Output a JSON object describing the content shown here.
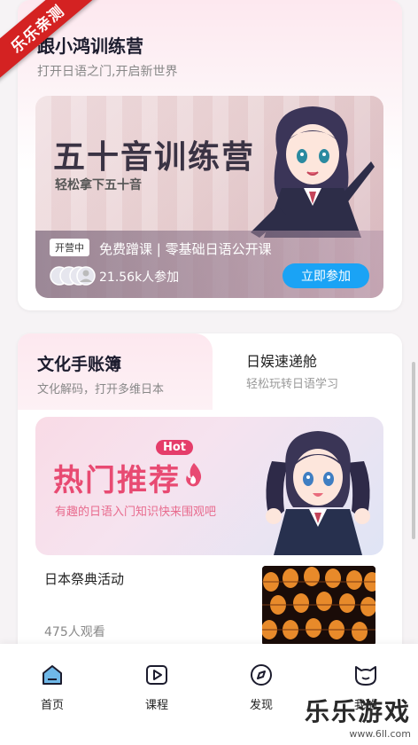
{
  "watermark": {
    "ribbon": "乐乐亲测",
    "site_name": "乐乐游戏",
    "site_url": "www.6ll.com"
  },
  "card1": {
    "title": "跟小鸿训练营",
    "subtitle": "打开日语之门,开启新世界",
    "banner": {
      "headline": "五十音训练营",
      "tagline": "轻松拿下五十音",
      "status_tag": "开营中",
      "lesson": "免费蹭课 | 零基础日语公开课",
      "participants": "21.56k人参加",
      "join_button": "立即参加"
    }
  },
  "card2": {
    "tabs": [
      {
        "title": "文化手账簿",
        "subtitle": "文化解码，打开多维日本"
      },
      {
        "title": "日娱速递舱",
        "subtitle": "轻松玩转日语学习"
      }
    ],
    "banner": {
      "headline": "热门推荐",
      "badge": "Hot",
      "description": "有趣的日语入门知识快来围观吧"
    },
    "item": {
      "title": "日本祭典活动",
      "views": "475人观看"
    }
  },
  "nav": [
    {
      "label": "首页",
      "icon": "home-icon"
    },
    {
      "label": "课程",
      "icon": "play-icon"
    },
    {
      "label": "发现",
      "icon": "compass-icon"
    },
    {
      "label": "我的",
      "icon": "cat-profile-icon"
    }
  ],
  "colors": {
    "accent_blue": "#1aa3f5",
    "hot_pink": "#e84a72",
    "ribbon_red": "#d42222"
  }
}
